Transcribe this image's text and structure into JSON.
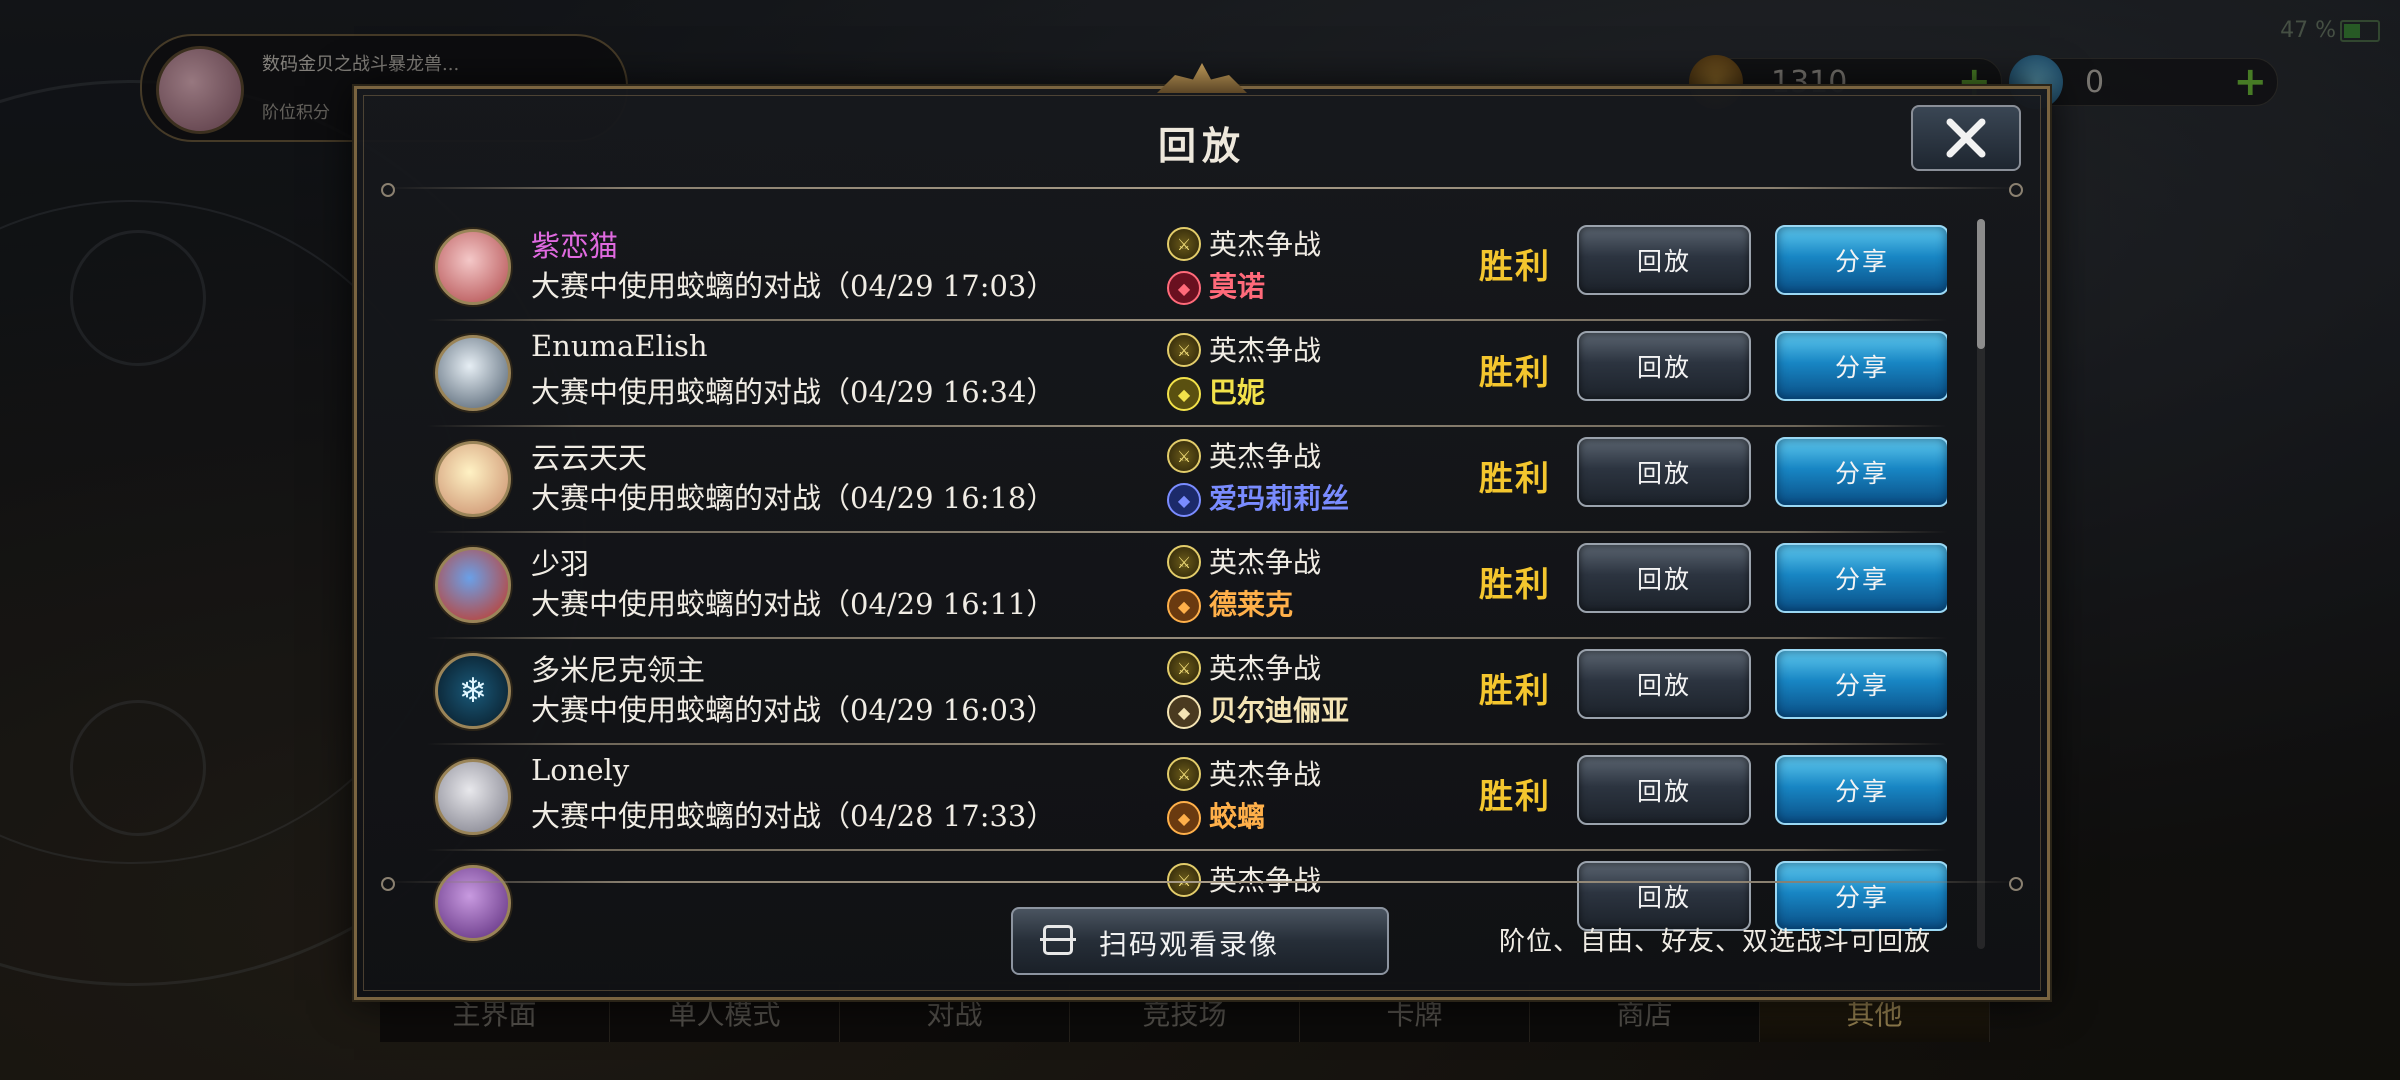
{
  "background": {
    "profile": {
      "line1": "数码金贝之战斗暴龙兽...",
      "line2": "阶位积分"
    },
    "currencies": [
      {
        "value": "1310",
        "plus": "+"
      },
      {
        "value": "0",
        "plus": "+"
      }
    ],
    "battery": "47 %",
    "bottom_nav": [
      "主界面",
      "单人模式",
      "对战",
      "竞技场",
      "卡牌",
      "商店",
      "其他"
    ]
  },
  "modal": {
    "title": "回放",
    "close_glyph": "✕",
    "rows": [
      {
        "player": "紫恋猫",
        "name_color": "#e06ae0",
        "desc": "大赛中使用蛟螭的对战（04/29 17:03）",
        "mode": "英杰争战",
        "leader": "莫诺",
        "leader_color": "#ff6a7a",
        "leader_icon_bg": "#6a1020",
        "result": "胜利",
        "replay": "回放",
        "share": "分享"
      },
      {
        "player": "EnumaElish",
        "name_color": "#f0ece4",
        "desc": "大赛中使用蛟螭的对战（04/29 16:34）",
        "mode": "英杰争战",
        "leader": "巴妮",
        "leader_color": "#f2e24a",
        "leader_icon_bg": "#5a5010",
        "result": "胜利",
        "replay": "回放",
        "share": "分享"
      },
      {
        "player": "云云天天",
        "name_color": "#f0ece4",
        "desc": "大赛中使用蛟螭的对战（04/29 16:18）",
        "mode": "英杰争战",
        "leader": "爱玛莉莉丝",
        "leader_color": "#7a8cff",
        "leader_icon_bg": "#1c2a6a",
        "result": "胜利",
        "replay": "回放",
        "share": "分享"
      },
      {
        "player": "少羽",
        "name_color": "#f0ece4",
        "desc": "大赛中使用蛟螭的对战（04/29 16:11）",
        "mode": "英杰争战",
        "leader": "德莱克",
        "leader_color": "#ffb04a",
        "leader_icon_bg": "#6a3a10",
        "result": "胜利",
        "replay": "回放",
        "share": "分享"
      },
      {
        "player": "多米尼克领主",
        "name_color": "#f0ece4",
        "desc": "大赛中使用蛟螭的对战（04/29 16:03）",
        "mode": "英杰争战",
        "leader": "贝尔迪俪亚",
        "leader_color": "#f4e4b4",
        "leader_icon_bg": "#4a3a20",
        "result": "胜利",
        "replay": "回放",
        "share": "分享"
      },
      {
        "player": "Lonely",
        "name_color": "#f0ece4",
        "desc": "大赛中使用蛟螭的对战（04/28 17:33）",
        "mode": "英杰争战",
        "leader": "蛟螭",
        "leader_color": "#ffb04a",
        "leader_icon_bg": "#6a3a10",
        "result": "胜利",
        "replay": "回放",
        "share": "分享"
      },
      {
        "player": "",
        "name_color": "#f0ece4",
        "desc": "",
        "mode": "英杰争战",
        "leader": "",
        "leader_color": "#f0ece4",
        "leader_icon_bg": "#333",
        "result": "",
        "replay": "回放",
        "share": "分享"
      }
    ],
    "scan_button": "扫码观看录像",
    "footer_note": "阶位、自由、好友、双选战斗可回放"
  },
  "colors": {
    "result": "#f4c62e",
    "share_button": "#1886c4",
    "replay_button": "#2c3440",
    "frame_gold": "#7a6440"
  }
}
